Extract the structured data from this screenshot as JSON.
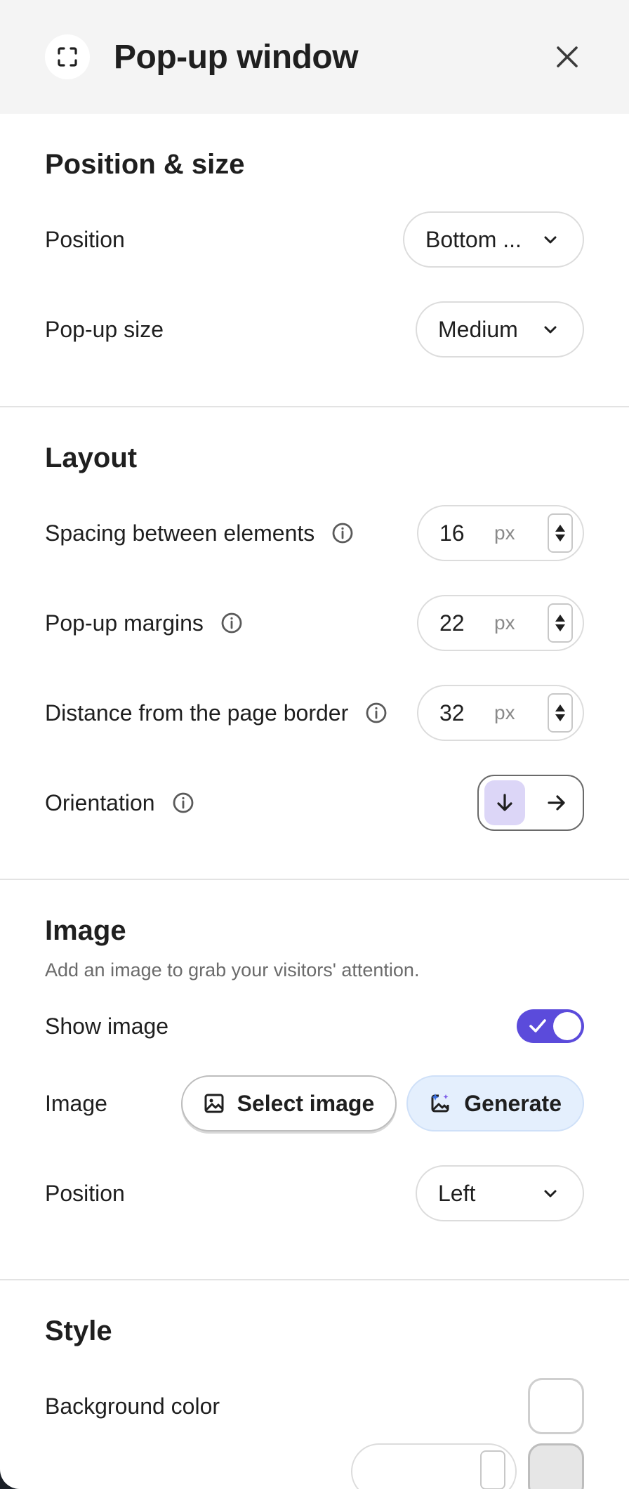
{
  "header": {
    "title": "Pop-up window",
    "icon": "expand-icon",
    "close_icon": "close-icon"
  },
  "position_size": {
    "title": "Position & size",
    "position_label": "Position",
    "position_value": "Bottom ...",
    "size_label": "Pop-up size",
    "size_value": "Medium"
  },
  "layout": {
    "title": "Layout",
    "spacing_label": "Spacing between elements",
    "spacing_value": "16",
    "margins_label": "Pop-up margins",
    "margins_value": "22",
    "distance_label": "Distance from the page border",
    "distance_value": "32",
    "unit": "px",
    "orientation_label": "Orientation",
    "orientation_selected": "vertical"
  },
  "image": {
    "title": "Image",
    "description": "Add an image to grab your visitors' attention.",
    "show_label": "Show image",
    "show_enabled": true,
    "image_label": "Image",
    "select_button": "Select image",
    "generate_button": "Generate",
    "position_label": "Position",
    "position_value": "Left"
  },
  "style": {
    "title": "Style",
    "bg_label": "Background color",
    "bg_color": "#ffffff"
  },
  "colors": {
    "accent": "#5b4bdb",
    "active_orient": "#dcd6f7",
    "generate_bg": "#e4effd"
  }
}
